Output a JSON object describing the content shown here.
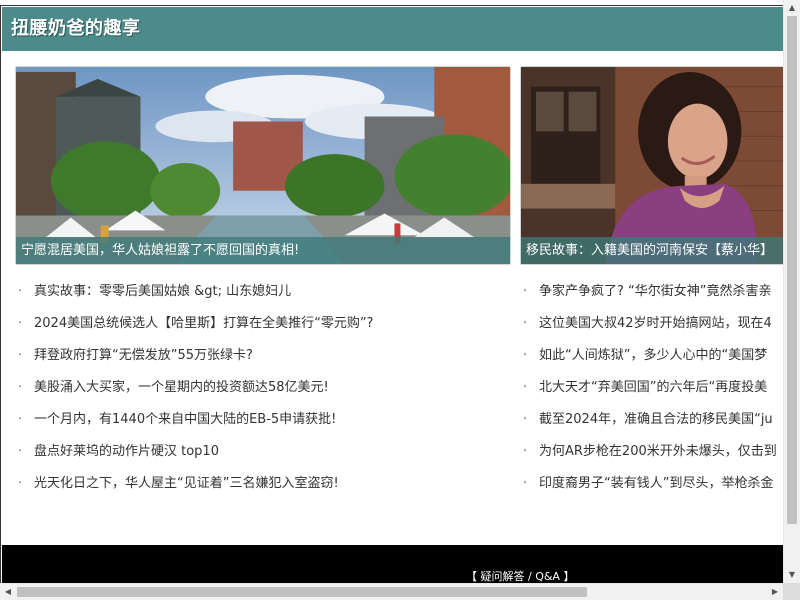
{
  "header": {
    "title": "扭腰奶爸的趣享"
  },
  "featured": [
    {
      "caption": "宁愿混居美国，华人姑娘袒露了不愿回国的真相!"
    },
    {
      "caption": "移民故事：入籍美国的河南保安【蔡小华】"
    }
  ],
  "lists": {
    "left": [
      "真实故事：零零后美国姑娘 &gt; 山东媳妇儿",
      "2024美国总统候选人【哈里斯】打算在全美推行“零元购”?",
      "拜登政府打算“无偿发放”55万张绿卡?",
      "美股涌入大买家，一个星期内的投资额达58亿美元!",
      "一个月内，有1440个来自中国大陆的EB-5申请获批!",
      "盘点好莱坞的动作片硬汉 top10",
      "光天化日之下，华人屋主“见证着”三名嫌犯入室盗窃!"
    ],
    "right": [
      "争家产争疯了? “华尔街女神”竟然杀害亲",
      "这位美国大叔42岁时开始搞网站，现在4",
      "如此“人间炼狱”，多少人心中的“美国梦",
      "北大天才“弃美回国”的六年后“再度投美",
      "截至2024年，准确且合法的移民美国“ju",
      "为何AR步枪在200米开外未爆头，仅击到",
      "印度裔男子“装有钱人”到尽头，举枪杀金"
    ]
  },
  "bullet": "·",
  "footer": {
    "link": "【 疑问解答 / Q&A 】"
  },
  "colors": {
    "header_bg": "#4c8b89",
    "caption_bg": "rgba(60,122,120,0.78)",
    "footer_bg": "#000000"
  }
}
